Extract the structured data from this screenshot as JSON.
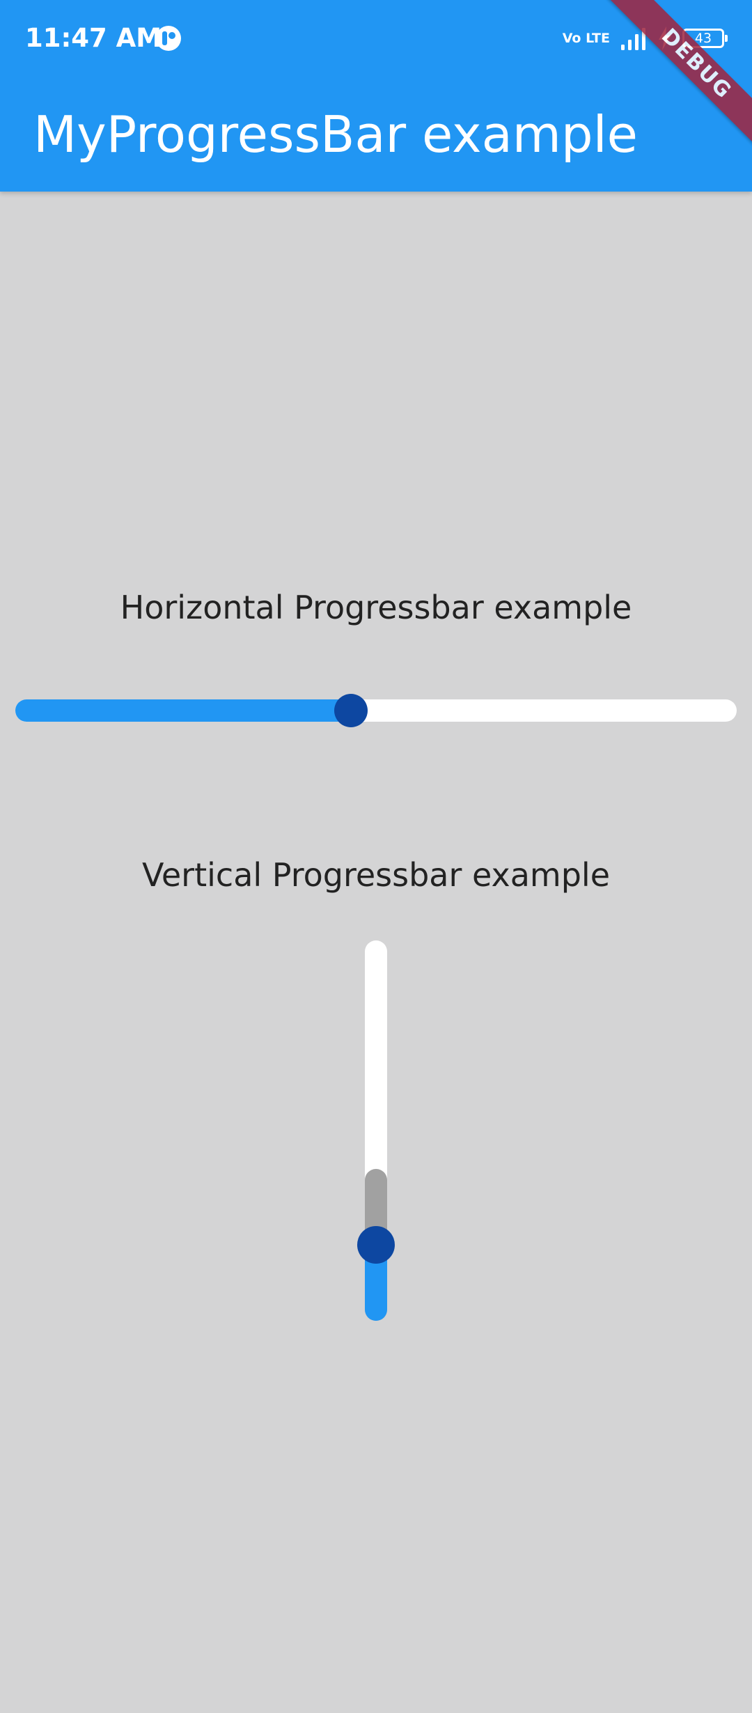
{
  "status_bar": {
    "time": "11:47 AM",
    "network_label": "Vo LTE",
    "battery_level": "43",
    "icons": [
      "app-notification-icon",
      "volte-icon",
      "signal-icon",
      "charging-icon",
      "battery-icon"
    ]
  },
  "app_bar": {
    "title": "MyProgressBar example",
    "color": "#2196f3"
  },
  "debug_banner": {
    "label": "DEBUG"
  },
  "horizontal": {
    "label": "Horizontal Progressbar example",
    "progress": 0.465,
    "fill_color": "#2196f3",
    "thumb_color": "#0d47a1",
    "track_color": "#ffffff"
  },
  "vertical": {
    "label": "Vertical Progressbar example",
    "progress": 0.2,
    "buffer": 0.4,
    "fill_color": "#2196f3",
    "buffer_color": "#a1a1a1",
    "thumb_color": "#0d47a1",
    "track_color": "#ffffff"
  },
  "background_color": "#d4d4d5"
}
